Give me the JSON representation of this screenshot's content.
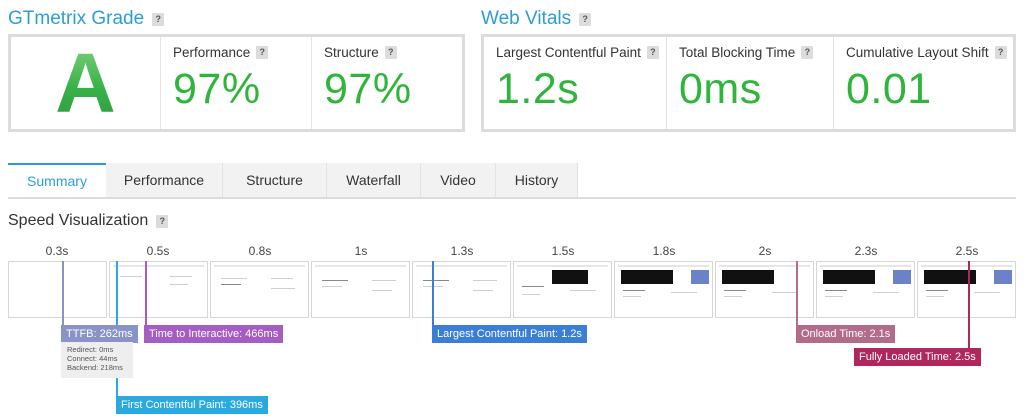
{
  "grade": {
    "title": "GTmetrix Grade",
    "help": "?",
    "letter": "A",
    "performance": {
      "label": "Performance",
      "value": "97%"
    },
    "structure": {
      "label": "Structure",
      "value": "97%"
    }
  },
  "web_vitals": {
    "title": "Web Vitals",
    "help": "?",
    "lcp": {
      "label": "Largest Contentful Paint",
      "value": "1.2s"
    },
    "tbt": {
      "label": "Total Blocking Time",
      "value": "0ms"
    },
    "cls": {
      "label": "Cumulative Layout Shift",
      "value": "0.01"
    }
  },
  "tabs": [
    "Summary",
    "Performance",
    "Structure",
    "Waterfall",
    "Video",
    "History"
  ],
  "speed": {
    "title": "Speed Visualization",
    "help": "?",
    "times": [
      "0.3s",
      "0.5s",
      "0.8s",
      "1s",
      "1.3s",
      "1.5s",
      "1.8s",
      "2s",
      "2.3s",
      "2.5s"
    ]
  },
  "markers": {
    "ttfb": {
      "label": "TTFB: 262ms",
      "color": "#8a93c7"
    },
    "ttfb_detail": [
      "Redirect: 0ms",
      "Connect: 44ms",
      "Backend: 218ms"
    ],
    "fcp": {
      "label": "First Contentful Paint: 396ms",
      "color": "#29a9df"
    },
    "tti": {
      "label": "Time to Interactive: 466ms",
      "color": "#a55dc3"
    },
    "lcp": {
      "label": "Largest Contentful Paint: 1.2s",
      "color": "#3a7ed6"
    },
    "onload": {
      "label": "Onload Time: 2.1s",
      "color": "#b26c8a"
    },
    "fully_loaded": {
      "label": "Fully Loaded Time: 2.5s",
      "color": "#b0275e"
    }
  },
  "colors": {
    "accent": "#2a9ed8",
    "good": "#2fb53c"
  }
}
